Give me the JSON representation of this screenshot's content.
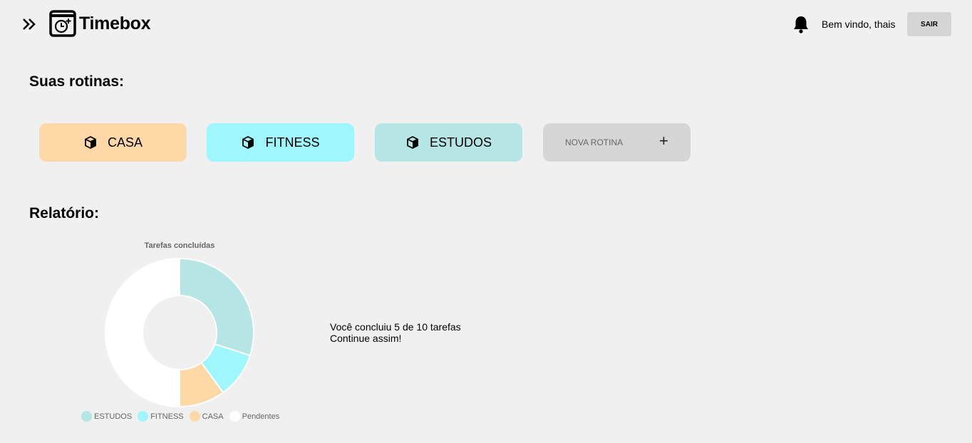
{
  "header": {
    "app_name": "Timebox",
    "welcome_text": "Bem vindo, thais",
    "logout_label": "SAIR",
    "icons": {
      "expand": "double-chevron-right-icon",
      "logo": "calendar-clock-icon",
      "notifications": "bell-icon"
    }
  },
  "routines": {
    "title": "Suas rotinas:",
    "items": [
      {
        "label": "CASA",
        "color": "#ffd8a8",
        "icon": "cube-icon"
      },
      {
        "label": "FITNESS",
        "color": "#9ff7fd",
        "icon": "cube-icon"
      },
      {
        "label": "ESTUDOS",
        "color": "#b5e5e5",
        "icon": "cube-icon"
      }
    ],
    "new_routine": {
      "label": "NOVA ROTINA",
      "plus": "+",
      "color": "#d6d6d6"
    }
  },
  "report": {
    "title": "Relatório:",
    "summary_line1": "Você concluiu 5 de 10 tarefas",
    "summary_line2": "Continue assim!"
  },
  "chart_data": {
    "type": "pie",
    "title": "Tarefas concluídas",
    "donut": true,
    "legend_position": "bottom",
    "categories": [
      "ESTUDOS",
      "FITNESS",
      "CASA",
      "Pendentes"
    ],
    "values": [
      3,
      1,
      1,
      5
    ],
    "colors": [
      "#b5e5e5",
      "#9ff7fd",
      "#ffd8a8",
      "#ffffff"
    ]
  }
}
